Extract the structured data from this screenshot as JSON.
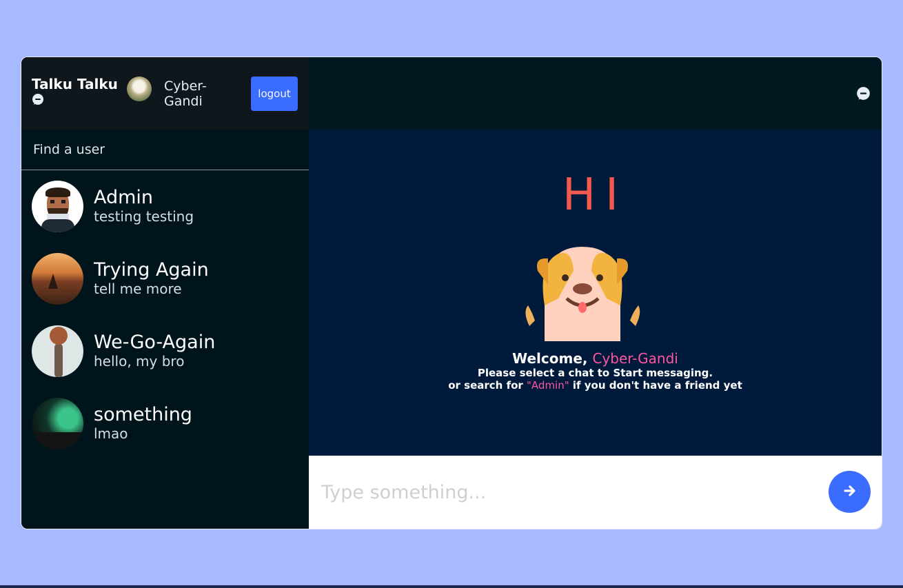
{
  "brand": {
    "title": "Talku Talku",
    "icon": "chat-bubble-icon"
  },
  "current_user": {
    "name": "Cyber-Gandi"
  },
  "header": {
    "logout_label": "logout",
    "chat_icon": "chat-bubble-icon"
  },
  "search": {
    "placeholder": "Find a user"
  },
  "chats": [
    {
      "name": "Admin",
      "last_message": "testing testing"
    },
    {
      "name": "Trying Again",
      "last_message": "tell me more"
    },
    {
      "name": "We-Go-Again",
      "last_message": "hello, my bro"
    },
    {
      "name": "something",
      "last_message": "lmao"
    }
  ],
  "welcome": {
    "hi": "HI",
    "greeting": "Welcome, ",
    "user": "Cyber-Gandi",
    "line1": "Please select a chat to Start messaging.",
    "line2_pre": "or search for ",
    "line2_highlight": "\"Admin\"",
    "line2_post": " if you don't have a friend yet"
  },
  "composer": {
    "placeholder": "Type something...",
    "send_icon": "arrow-right-icon"
  },
  "colors": {
    "background": "#a7baff",
    "sidebar": "#00141b",
    "main": "#001a3b",
    "accent": "#3a6cff",
    "highlight": "#ff56a2",
    "hi": "#f2594f"
  }
}
